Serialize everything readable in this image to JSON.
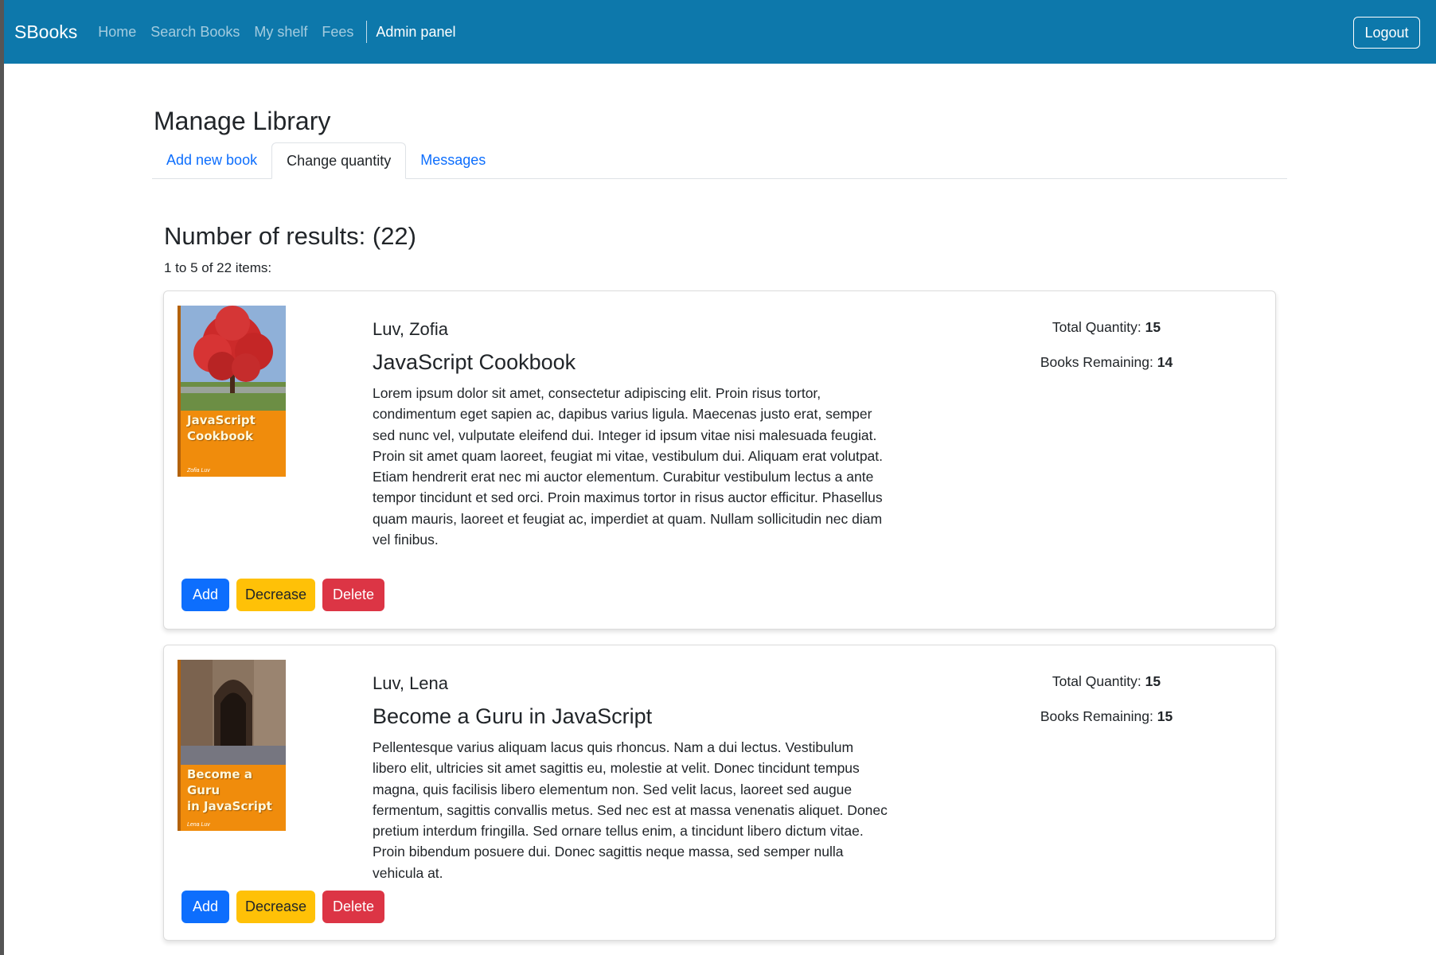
{
  "navbar": {
    "brand": "SBooks",
    "links": [
      "Home",
      "Search Books",
      "My shelf",
      "Fees"
    ],
    "admin_link": "Admin panel",
    "logout_label": "Logout"
  },
  "page": {
    "title": "Manage Library",
    "tabs": [
      "Add new book",
      "Change quantity",
      "Messages"
    ],
    "active_tab": "Change quantity"
  },
  "results": {
    "heading": "Number of results: (22)",
    "range": "1 to 5 of 22 items:"
  },
  "books": [
    {
      "author": "Luv, Zofia",
      "title": "JavaScript Cookbook",
      "description": "Lorem ipsum dolor sit amet, consectetur adipiscing elit. Proin risus tortor, condimentum eget sapien ac, dapibus varius ligula. Maecenas justo erat, semper sed nunc vel, vulputate eleifend dui. Integer id ipsum vitae nisi malesuada feugiat. Proin sit amet quam laoreet, feugiat mi vitae, vestibulum dui. Aliquam erat volutpat. Etiam hendrerit erat nec mi auctor elementum. Curabitur vestibulum lectus a ante tempor tincidunt et sed orci. Proin maximus tortor in risus auctor efficitur. Phasellus quam mauris, laoreet et feugiat ac, imperdiet at quam. Nullam sollicitudin nec diam vel finibus.",
      "cover_line1": "JavaScript",
      "cover_line2": "Cookbook",
      "cover_author": "Zofia Luv",
      "total_label": "Total Quantity:",
      "total": "15",
      "remaining_label": "Books Remaining:",
      "remaining": "14",
      "add_label": "Add",
      "decrease_label": "Decrease",
      "delete_label": "Delete"
    },
    {
      "author": "Luv, Lena",
      "title": "Become a Guru in JavaScript",
      "description": "Pellentesque varius aliquam lacus quis rhoncus. Nam a dui lectus. Vestibulum libero elit, ultricies sit amet sagittis eu, molestie at velit. Donec tincidunt tempus magna, quis facilisis libero elementum non. Sed velit lacus, laoreet sed augue fermentum, sagittis convallis metus. Sed nec est at massa venenatis aliquet. Donec pretium interdum fringilla. Sed ornare tellus enim, a tincidunt libero dictum vitae. Proin bibendum posuere dui. Donec sagittis neque massa, sed semper nulla vehicula at.",
      "cover_line1": "Become a Guru",
      "cover_line2": "in JavaScript",
      "cover_author": "Lena Luv",
      "total_label": "Total Quantity:",
      "total": "15",
      "remaining_label": "Books Remaining:",
      "remaining": "15",
      "add_label": "Add",
      "decrease_label": "Decrease",
      "delete_label": "Delete"
    }
  ],
  "colors": {
    "navbar": "#0d78ab",
    "primary": "#0d6efd",
    "warning": "#ffc107",
    "danger": "#dc3545",
    "cover": "#f08c0c"
  }
}
